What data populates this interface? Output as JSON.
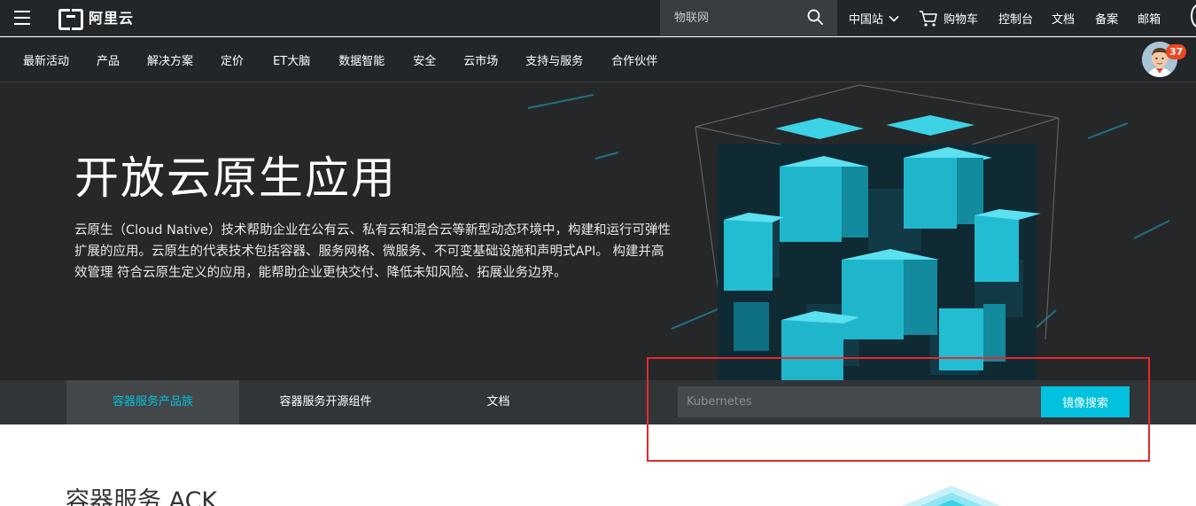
{
  "header": {
    "logo_text": "阿里云",
    "search_placeholder": "物联网",
    "links": [
      {
        "label": "中国站",
        "icon": "chevron-down-icon"
      },
      {
        "label": "购物车",
        "icon": "cart-icon"
      },
      {
        "label": "控制台"
      },
      {
        "label": "文档"
      },
      {
        "label": "备案"
      },
      {
        "label": "邮箱"
      }
    ]
  },
  "nav": {
    "items": [
      "最新活动",
      "产品",
      "解决方案",
      "定价",
      "ET大脑",
      "数据智能",
      "安全",
      "云市场",
      "支持与服务",
      "合作伙伴"
    ],
    "notification_count": "37"
  },
  "hero": {
    "title": "开放云原生应用",
    "description": "云原生（Cloud Native）技术帮助企业在公有云、私有云和混合云等新型动态环境中，构建和运行可弹性扩展的应用。云原生的代表技术包括容器、服务网格、微服务、不可变基础设施和声明式API。 构建并高效管理 符合云原生定义的应用，能帮助企业更快交付、降低未知风险、拓展业务边界。"
  },
  "tabs": {
    "items": [
      "容器服务产品族",
      "容器服务开源组件",
      "文档"
    ],
    "active_index": 0,
    "search_placeholder": "Kubernetes",
    "search_button": "镜像搜索"
  },
  "content": {
    "section_title": "容器服务 ACK"
  },
  "colors": {
    "accent": "#00c1de",
    "header_bg": "#232629",
    "hero_bg": "#262729",
    "badge": "#ee4622",
    "highlight": "#e8282b"
  }
}
